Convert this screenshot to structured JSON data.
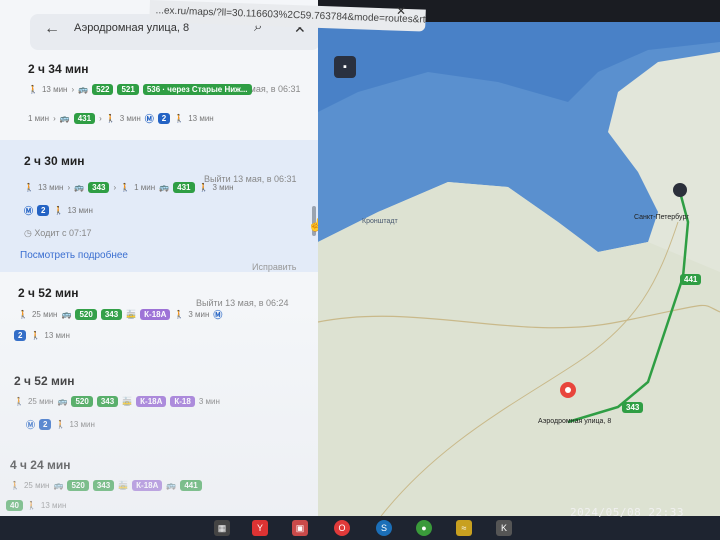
{
  "browser": {
    "url": "...ex.ru/maps/?ll=30.116603%2C59.763784&mode=routes&rtext=59.9...&rtt=auto...",
    "close_icon": "close-icon"
  },
  "search": {
    "value": "Аэродромная улица, 8",
    "back_icon": "back-arrow-icon",
    "search_icon": "search-icon",
    "clear_icon": "close-icon"
  },
  "routes": [
    {
      "duration": "2 ч 34 мин",
      "depart": "Выйти 13 мая, в 06:31",
      "line1": {
        "walk": "13 мин",
        "badges": [
          "522",
          "521",
          "536 · через Старые Ниж..."
        ]
      },
      "line2": {
        "walk_start": "1 мин",
        "bus": "431",
        "walk_mid": "3 мин",
        "metro_line": "2",
        "walk_end": "13 мин"
      }
    },
    {
      "duration": "2 ч 30 мин",
      "depart": "Выйти 13 мая, в 06:31",
      "line1": {
        "walk": "13 мин",
        "bus": "343",
        "walk_mid": "1 мин",
        "bus2": "431",
        "walk_end": "3 мин"
      },
      "line2": {
        "metro_line": "2",
        "walk_end": "13 мин"
      },
      "frequency": "Ходит с 07:17",
      "more": "Посмотреть подробнее",
      "fix": "Исправить"
    },
    {
      "duration": "2 ч 52 мин",
      "depart": "Выйти 13 мая, в 06:24",
      "line1": {
        "walk": "25 мин",
        "badges": [
          "520",
          "343"
        ],
        "tram": "К-18А",
        "walk_end": "3 мин"
      },
      "line2": {
        "metro_line": "2",
        "walk_end": "13 мин"
      }
    },
    {
      "duration": "2 ч 52 мин",
      "depart": "",
      "line1": {
        "walk": "25 мин",
        "badges": [
          "520",
          "343"
        ],
        "tram": [
          "К-18А",
          "К-18"
        ],
        "walk_end": "3 мин"
      },
      "line2": {
        "metro_line": "2",
        "walk_end": "13 мин"
      }
    },
    {
      "duration": "4 ч 24 мин",
      "depart": "",
      "line1": {
        "walk": "25 мин",
        "badges": [
          "520",
          "343"
        ],
        "tram": "К-18А",
        "bus": "441"
      },
      "line2": {
        "bus": "40",
        "walk_end": "13 мин"
      }
    }
  ],
  "map": {
    "labels": {
      "kronstadt": "Кронштадт",
      "destination": "Аэродромная улица, 8",
      "spb": "Санкт-Петербург",
      "bus_441": "441",
      "bus_343": "343"
    },
    "colors": {
      "water": "#4c83c8",
      "land": "#dfe3d6",
      "route": "#2f9e44",
      "marker": "#e8453c"
    }
  },
  "timestamp": "2024/05/08  22:33"
}
